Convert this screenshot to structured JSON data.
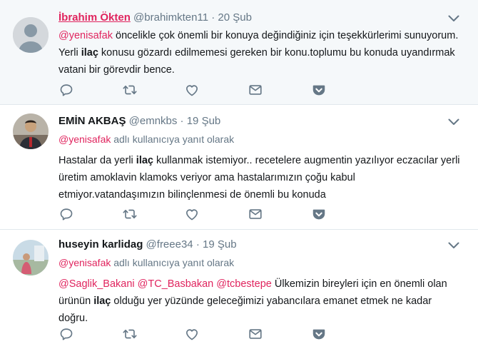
{
  "tweets": [
    {
      "name": "İbrahim Ökten",
      "handle": "@brahimkten11",
      "dot": "·",
      "date": "20 Şub",
      "mention": "@yenisafak",
      "text_before": " öncelikle çok önemli bir konuya değindiğiniz için teşekkürlerimi sunuyorum. Yerli ",
      "bold": "ilaç",
      "text_after": " konusu gözardı edilmemesi gereken bir konu.toplumu bu konuda uyandırmak vatani bir görevdir bence."
    },
    {
      "name": "EMİN AKBAŞ",
      "handle": "@emnkbs",
      "dot": "·",
      "date": "19 Şub",
      "reply_mention": "@yenisafak",
      "reply_text": " adlı kullanıcıya yanıt olarak",
      "text_before": "Hastalar da yerli ",
      "bold": "ilaç",
      "text_after": " kullanmak istemiyor.. recetelere augmentin yazılıyor eczacılar yerli üretim amoklavin klamoks veriyor ama hastalarımızın çoğu kabul etmiyor.vatandaşımızın bilinçlenmesi de önemli bu konuda"
    },
    {
      "name": "huseyin karlidag",
      "handle": "@freee34",
      "dot": "·",
      "date": "19 Şub",
      "reply_mention": "@yenisafak",
      "reply_text": " adlı kullanıcıya yanıt olarak",
      "mentions": "@Saglik_Bakani @TC_Basbakan @tcbestepe",
      "text_before": " Ülkemizin bireyleri için en önemli olan ürünün ",
      "bold": "ilaç",
      "text_after": " olduğu yer yüzünde geleceğimizi yabancılara emanet etmek ne kadar doğru."
    }
  ],
  "icons": [
    "reply-icon",
    "retweet-icon",
    "like-icon",
    "message-icon",
    "pocket-icon",
    "chevron-down-icon"
  ],
  "colors": {
    "accent": "#e0245e",
    "muted": "#657786",
    "icon": "#657786",
    "divider": "#e1e8ed",
    "highlight_bg": "#f5f8fa"
  }
}
